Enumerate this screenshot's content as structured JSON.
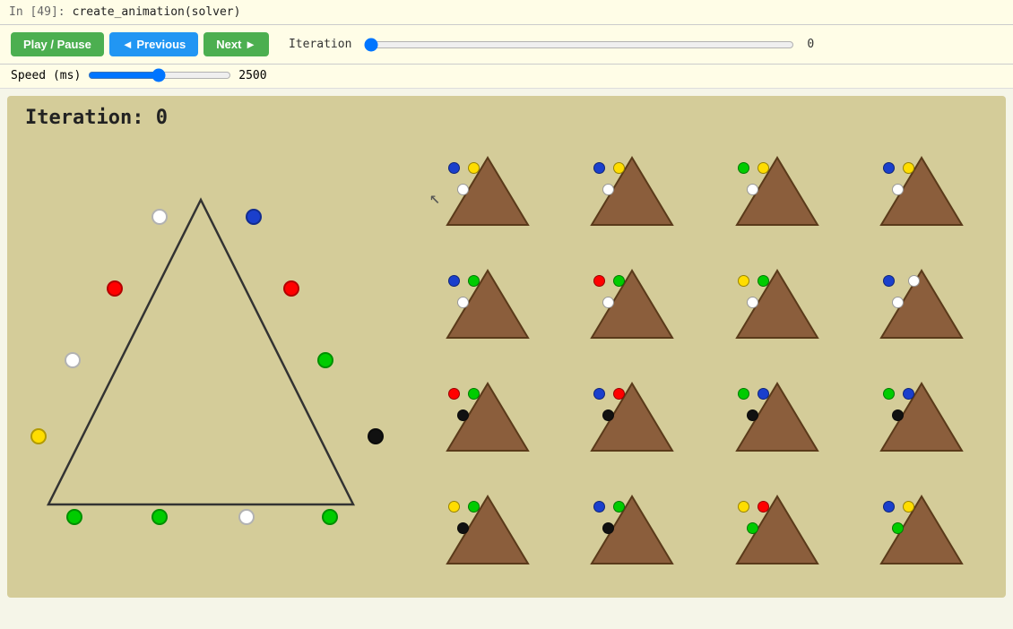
{
  "notebook": {
    "cell_label": "In [49]:",
    "cell_code": "create_animation(solver)"
  },
  "controls": {
    "play_pause_label": "Play / Pause",
    "previous_label": "◄ Previous",
    "next_label": "Next ►",
    "iteration_label": "Iteration",
    "iteration_value": "0",
    "speed_label": "Speed (ms)",
    "speed_value": "2500"
  },
  "main": {
    "iteration_title": "Iteration: 0"
  },
  "colors": {
    "bg": "#d4cc99",
    "triangle_fill": "#8B5E3C",
    "triangle_stroke": "#5a3a1a",
    "btn_green": "#4caf50",
    "btn_blue": "#2196f3"
  }
}
